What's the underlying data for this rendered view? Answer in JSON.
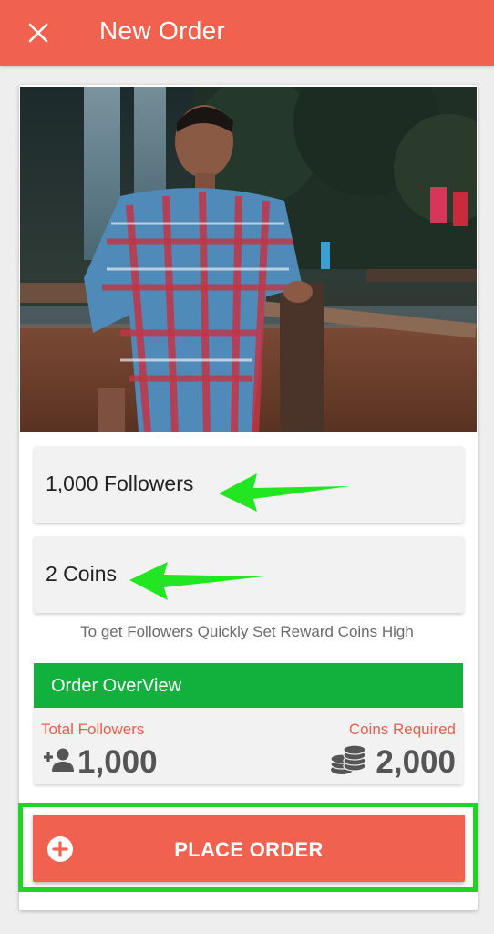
{
  "header": {
    "title": "New Order",
    "close_icon": "close-icon",
    "color": "#f0624f"
  },
  "photo": {
    "description_icon": "profile-photo"
  },
  "followers_field": {
    "value": "1,000 Followers"
  },
  "coins_field": {
    "value": "2 Coins"
  },
  "hint": "To get Followers Quickly Set Reward Coins High",
  "overview": {
    "title": "Order OverView",
    "total_followers_label": "Total Followers",
    "total_followers_value": "1,000",
    "coins_required_label": "Coins Required",
    "coins_required_value": "2,000",
    "accent": "#12b03c",
    "label_color": "#e8604c"
  },
  "place_order": {
    "label": "PLACE ORDER",
    "icon": "add-circle-icon",
    "highlight_color": "#22d422"
  },
  "annotation_color": "#22d422"
}
